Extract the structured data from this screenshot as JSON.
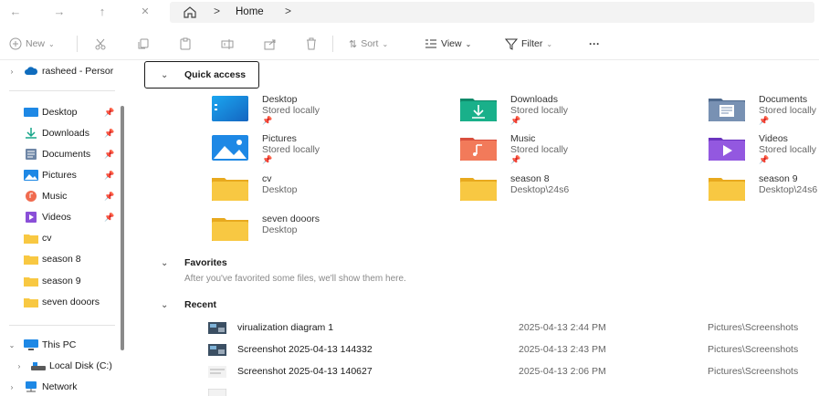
{
  "address": {
    "breadcrumb": [
      "Home"
    ],
    "separator": ">"
  },
  "nav": {
    "back": "←",
    "forward": "→",
    "up": "↑",
    "close": "✕"
  },
  "commands": {
    "new_label": "New",
    "sort_label": "Sort",
    "view_label": "View",
    "filter_label": "Filter",
    "more_label": "···"
  },
  "sidebar": {
    "onedrive": "rasheed - Persor",
    "pinned": [
      {
        "label": "Desktop",
        "icon": "desktop-icon",
        "pin": "📌"
      },
      {
        "label": "Downloads",
        "icon": "download-icon",
        "pin": "📌"
      },
      {
        "label": "Documents",
        "icon": "documents-icon",
        "pin": "📌"
      },
      {
        "label": "Pictures",
        "icon": "pictures-icon",
        "pin": "📌"
      },
      {
        "label": "Music",
        "icon": "music-icon",
        "pin": "📌"
      },
      {
        "label": "Videos",
        "icon": "videos-icon",
        "pin": "📌"
      }
    ],
    "folders": [
      "cv",
      "season 8",
      "season 9",
      "seven dooors"
    ],
    "this_pc": "This PC",
    "local_disk": "Local Disk (C:)",
    "network": "Network"
  },
  "quick_access": {
    "heading": "Quick access",
    "items": [
      {
        "name": "Desktop",
        "sub": "Stored locally",
        "pinned": true,
        "icon": "desktop-folder-icon"
      },
      {
        "name": "Downloads",
        "sub": "Stored locally",
        "pinned": true,
        "icon": "downloads-folder-icon"
      },
      {
        "name": "Documents",
        "sub": "Stored locally",
        "pinned": true,
        "icon": "documents-folder-icon"
      },
      {
        "name": "Pictures",
        "sub": "Stored locally",
        "pinned": true,
        "icon": "pictures-folder-icon"
      },
      {
        "name": "Music",
        "sub": "Stored locally",
        "pinned": true,
        "icon": "music-folder-icon"
      },
      {
        "name": "Videos",
        "sub": "Stored locally",
        "pinned": true,
        "icon": "videos-folder-icon"
      },
      {
        "name": "cv",
        "sub": "Desktop",
        "pinned": false,
        "icon": "folder-icon"
      },
      {
        "name": "season 8",
        "sub": "Desktop\\24s6",
        "pinned": false,
        "icon": "folder-icon"
      },
      {
        "name": "season 9",
        "sub": "Desktop\\24s6",
        "pinned": false,
        "icon": "folder-icon"
      },
      {
        "name": "seven dooors",
        "sub": "Desktop",
        "pinned": false,
        "icon": "folder-icon"
      }
    ],
    "pin_glyph": "📌"
  },
  "favorites": {
    "heading": "Favorites",
    "message": "After you've favorited some files, we'll show them here."
  },
  "recent": {
    "heading": "Recent",
    "rows": [
      {
        "name": "virualization diagram 1",
        "date": "2025-04-13 2:44 PM",
        "location": "Pictures\\Screenshots"
      },
      {
        "name": "Screenshot 2025-04-13 144332",
        "date": "2025-04-13 2:43 PM",
        "location": "Pictures\\Screenshots"
      },
      {
        "name": "Screenshot 2025-04-13 140627",
        "date": "2025-04-13 2:06 PM",
        "location": "Pictures\\Screenshots"
      }
    ]
  },
  "colors": {
    "folder": "#f8c842",
    "folder_dark": "#e8a91e",
    "accent_blue": "#1e88e5",
    "downloads_green": "#17a589",
    "music_orange": "#f06b4f",
    "videos_purple": "#8a4fd8",
    "documents_slate": "#6e86a6"
  }
}
